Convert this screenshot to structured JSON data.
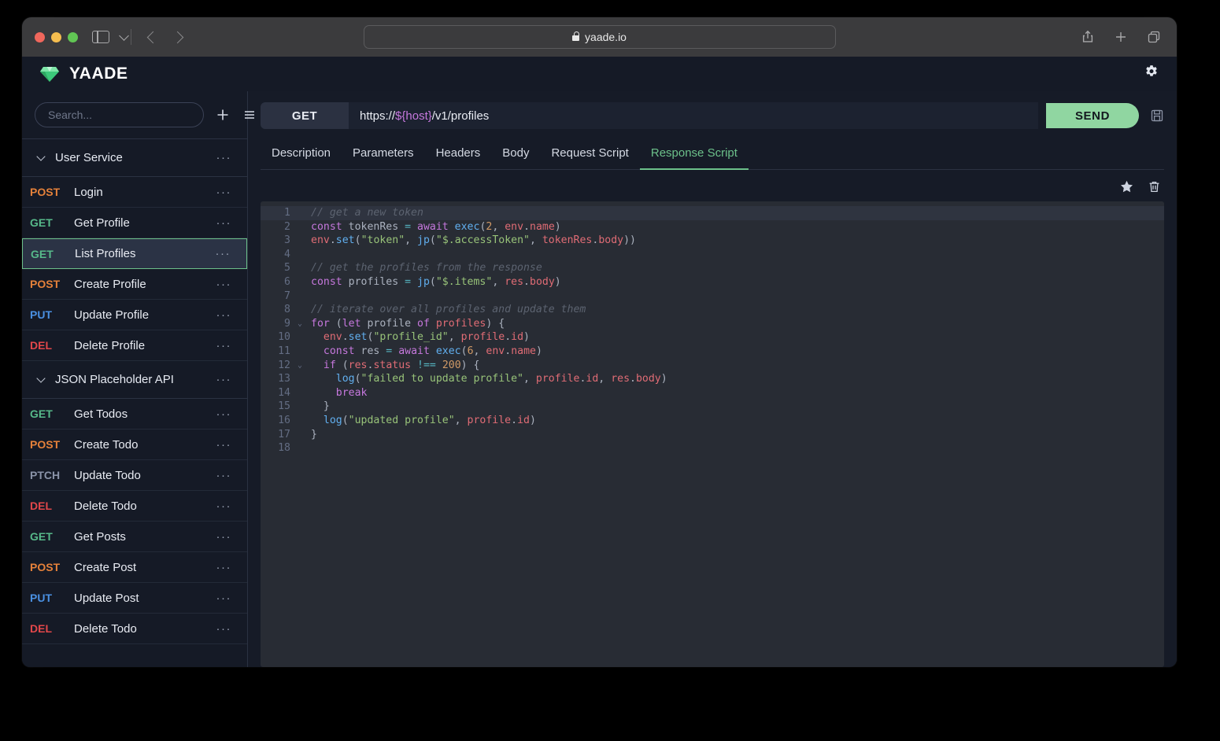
{
  "browser": {
    "url": "yaade.io",
    "lock_icon": "lock-icon",
    "back_icon": "back-arrow-icon",
    "forward_icon": "forward-arrow-icon",
    "sidebar_toggle_icon": "sidebar-toggle-icon",
    "share_icon": "share-icon",
    "new_tab_icon": "plus-icon",
    "tabs_icon": "tabs-overview-icon"
  },
  "app": {
    "title": "YAADE",
    "logo_icon": "gem-icon",
    "settings_icon": "gear-icon"
  },
  "sidebar": {
    "search": {
      "value": "",
      "placeholder": "Search..."
    },
    "add_icon": "plus-icon",
    "menu_icon": "hamburger-menu-icon",
    "overflow_label": "···",
    "groups": [
      {
        "name": "User Service",
        "expanded": true,
        "requests": [
          {
            "method": "POST",
            "name": "Login",
            "selected": false
          },
          {
            "method": "GET",
            "name": "Get Profile",
            "selected": false
          },
          {
            "method": "GET",
            "name": "List Profiles",
            "selected": true
          },
          {
            "method": "POST",
            "name": "Create Profile",
            "selected": false
          },
          {
            "method": "PUT",
            "name": "Update Profile",
            "selected": false
          },
          {
            "method": "DEL",
            "name": "Delete Profile",
            "selected": false
          }
        ]
      },
      {
        "name": "JSON Placeholder API",
        "expanded": true,
        "requests": [
          {
            "method": "GET",
            "name": "Get Todos",
            "selected": false
          },
          {
            "method": "POST",
            "name": "Create Todo",
            "selected": false
          },
          {
            "method": "PTCH",
            "name": "Update Todo",
            "selected": false
          },
          {
            "method": "DEL",
            "name": "Delete Todo",
            "selected": false
          },
          {
            "method": "GET",
            "name": "Get Posts",
            "selected": false
          },
          {
            "method": "POST",
            "name": "Create Post",
            "selected": false
          },
          {
            "method": "PUT",
            "name": "Update Post",
            "selected": false
          },
          {
            "method": "DEL",
            "name": "Delete Todo",
            "selected": false
          }
        ]
      }
    ]
  },
  "request": {
    "method": "GET",
    "url_prefix": "https://",
    "url_variable": "${host}",
    "url_suffix": "/v1/profiles",
    "send_label": "SEND",
    "save_icon": "floppy-disk-save-icon"
  },
  "tabs": [
    {
      "label": "Description",
      "active": false
    },
    {
      "label": "Parameters",
      "active": false
    },
    {
      "label": "Headers",
      "active": false
    },
    {
      "label": "Body",
      "active": false
    },
    {
      "label": "Request Script",
      "active": false
    },
    {
      "label": "Response Script",
      "active": true
    }
  ],
  "editor_tools": {
    "star_icon": "star-icon",
    "trash_icon": "trash-icon"
  },
  "colors": {
    "accent_green": "#6cc08a",
    "send_green": "#90d6a1",
    "method_get": "#57b98a",
    "method_post": "#e5813a",
    "method_put": "#4a90e2",
    "method_del": "#e2474a",
    "method_patch": "#8a93a8",
    "url_variable": "#c678dd",
    "editor_bg": "#282c34",
    "app_bg": "#161b27"
  },
  "code": {
    "total_lines": 18,
    "highlight_line": 1,
    "fold_lines": [
      9,
      12
    ],
    "lines": [
      {
        "n": 1,
        "tokens": [
          {
            "t": "com",
            "v": "// get a new token"
          }
        ]
      },
      {
        "n": 2,
        "tokens": [
          {
            "t": "kw",
            "v": "const"
          },
          {
            "t": "pl",
            "v": " tokenRes "
          },
          {
            "t": "op",
            "v": "="
          },
          {
            "t": "pl",
            "v": " "
          },
          {
            "t": "kw",
            "v": "await"
          },
          {
            "t": "pl",
            "v": " "
          },
          {
            "t": "fn",
            "v": "exec"
          },
          {
            "t": "pl",
            "v": "("
          },
          {
            "t": "num",
            "v": "2"
          },
          {
            "t": "pl",
            "v": ", "
          },
          {
            "t": "var",
            "v": "env"
          },
          {
            "t": "pl",
            "v": "."
          },
          {
            "t": "var",
            "v": "name"
          },
          {
            "t": "pl",
            "v": ")"
          }
        ]
      },
      {
        "n": 3,
        "tokens": [
          {
            "t": "var",
            "v": "env"
          },
          {
            "t": "pl",
            "v": "."
          },
          {
            "t": "fn",
            "v": "set"
          },
          {
            "t": "pl",
            "v": "("
          },
          {
            "t": "str",
            "v": "\"token\""
          },
          {
            "t": "pl",
            "v": ", "
          },
          {
            "t": "fn",
            "v": "jp"
          },
          {
            "t": "pl",
            "v": "("
          },
          {
            "t": "str",
            "v": "\"$.accessToken\""
          },
          {
            "t": "pl",
            "v": ", "
          },
          {
            "t": "var",
            "v": "tokenRes"
          },
          {
            "t": "pl",
            "v": "."
          },
          {
            "t": "var",
            "v": "body"
          },
          {
            "t": "pl",
            "v": "))"
          }
        ]
      },
      {
        "n": 4,
        "tokens": []
      },
      {
        "n": 5,
        "tokens": [
          {
            "t": "com",
            "v": "// get the profiles from the response"
          }
        ]
      },
      {
        "n": 6,
        "tokens": [
          {
            "t": "kw",
            "v": "const"
          },
          {
            "t": "pl",
            "v": " profiles "
          },
          {
            "t": "op",
            "v": "="
          },
          {
            "t": "pl",
            "v": " "
          },
          {
            "t": "fn",
            "v": "jp"
          },
          {
            "t": "pl",
            "v": "("
          },
          {
            "t": "str",
            "v": "\"$.items\""
          },
          {
            "t": "pl",
            "v": ", "
          },
          {
            "t": "var",
            "v": "res"
          },
          {
            "t": "pl",
            "v": "."
          },
          {
            "t": "var",
            "v": "body"
          },
          {
            "t": "pl",
            "v": ")"
          }
        ]
      },
      {
        "n": 7,
        "tokens": []
      },
      {
        "n": 8,
        "tokens": [
          {
            "t": "com",
            "v": "// iterate over all profiles and update them"
          }
        ]
      },
      {
        "n": 9,
        "tokens": [
          {
            "t": "kw",
            "v": "for"
          },
          {
            "t": "pl",
            "v": " ("
          },
          {
            "t": "kw",
            "v": "let"
          },
          {
            "t": "pl",
            "v": " profile "
          },
          {
            "t": "kw",
            "v": "of"
          },
          {
            "t": "pl",
            "v": " "
          },
          {
            "t": "var",
            "v": "profiles"
          },
          {
            "t": "pl",
            "v": ") {"
          }
        ]
      },
      {
        "n": 10,
        "tokens": [
          {
            "t": "pl",
            "v": "  "
          },
          {
            "t": "var",
            "v": "env"
          },
          {
            "t": "pl",
            "v": "."
          },
          {
            "t": "fn",
            "v": "set"
          },
          {
            "t": "pl",
            "v": "("
          },
          {
            "t": "str",
            "v": "\"profile_id\""
          },
          {
            "t": "pl",
            "v": ", "
          },
          {
            "t": "var",
            "v": "profile"
          },
          {
            "t": "pl",
            "v": "."
          },
          {
            "t": "var",
            "v": "id"
          },
          {
            "t": "pl",
            "v": ")"
          }
        ]
      },
      {
        "n": 11,
        "tokens": [
          {
            "t": "pl",
            "v": "  "
          },
          {
            "t": "kw",
            "v": "const"
          },
          {
            "t": "pl",
            "v": " res "
          },
          {
            "t": "op",
            "v": "="
          },
          {
            "t": "pl",
            "v": " "
          },
          {
            "t": "kw",
            "v": "await"
          },
          {
            "t": "pl",
            "v": " "
          },
          {
            "t": "fn",
            "v": "exec"
          },
          {
            "t": "pl",
            "v": "("
          },
          {
            "t": "num",
            "v": "6"
          },
          {
            "t": "pl",
            "v": ", "
          },
          {
            "t": "var",
            "v": "env"
          },
          {
            "t": "pl",
            "v": "."
          },
          {
            "t": "var",
            "v": "name"
          },
          {
            "t": "pl",
            "v": ")"
          }
        ]
      },
      {
        "n": 12,
        "tokens": [
          {
            "t": "pl",
            "v": "  "
          },
          {
            "t": "kw",
            "v": "if"
          },
          {
            "t": "pl",
            "v": " ("
          },
          {
            "t": "var",
            "v": "res"
          },
          {
            "t": "pl",
            "v": "."
          },
          {
            "t": "var",
            "v": "status"
          },
          {
            "t": "pl",
            "v": " "
          },
          {
            "t": "op",
            "v": "!=="
          },
          {
            "t": "pl",
            "v": " "
          },
          {
            "t": "num",
            "v": "200"
          },
          {
            "t": "pl",
            "v": ") {"
          }
        ]
      },
      {
        "n": 13,
        "tokens": [
          {
            "t": "pl",
            "v": "    "
          },
          {
            "t": "fn",
            "v": "log"
          },
          {
            "t": "pl",
            "v": "("
          },
          {
            "t": "str",
            "v": "\"failed to update profile\""
          },
          {
            "t": "pl",
            "v": ", "
          },
          {
            "t": "var",
            "v": "profile"
          },
          {
            "t": "pl",
            "v": "."
          },
          {
            "t": "var",
            "v": "id"
          },
          {
            "t": "pl",
            "v": ", "
          },
          {
            "t": "var",
            "v": "res"
          },
          {
            "t": "pl",
            "v": "."
          },
          {
            "t": "var",
            "v": "body"
          },
          {
            "t": "pl",
            "v": ")"
          }
        ]
      },
      {
        "n": 14,
        "tokens": [
          {
            "t": "pl",
            "v": "    "
          },
          {
            "t": "kw",
            "v": "break"
          }
        ]
      },
      {
        "n": 15,
        "tokens": [
          {
            "t": "pl",
            "v": "  }"
          }
        ]
      },
      {
        "n": 16,
        "tokens": [
          {
            "t": "pl",
            "v": "  "
          },
          {
            "t": "fn",
            "v": "log"
          },
          {
            "t": "pl",
            "v": "("
          },
          {
            "t": "str",
            "v": "\"updated profile\""
          },
          {
            "t": "pl",
            "v": ", "
          },
          {
            "t": "var",
            "v": "profile"
          },
          {
            "t": "pl",
            "v": "."
          },
          {
            "t": "var",
            "v": "id"
          },
          {
            "t": "pl",
            "v": ")"
          }
        ]
      },
      {
        "n": 17,
        "tokens": [
          {
            "t": "pl",
            "v": "}"
          }
        ]
      },
      {
        "n": 18,
        "tokens": []
      }
    ]
  }
}
